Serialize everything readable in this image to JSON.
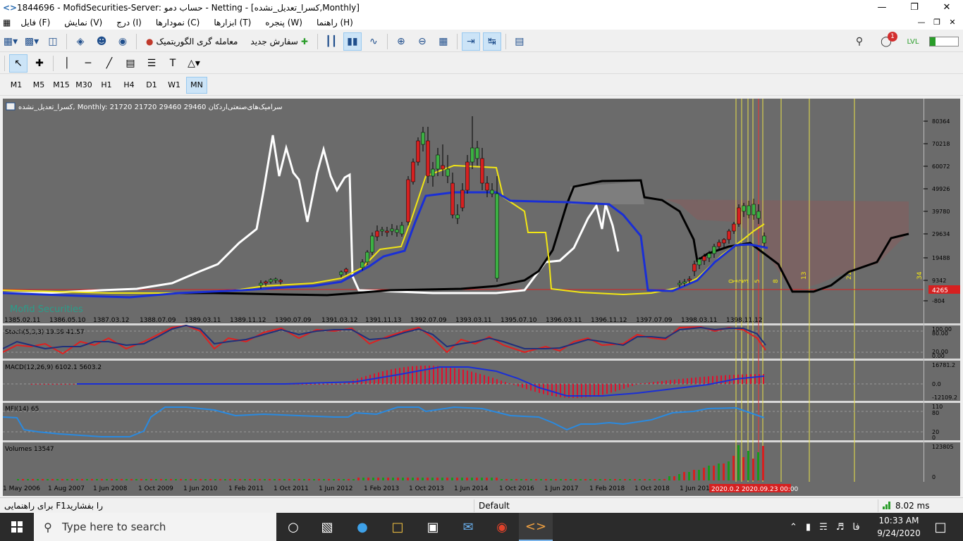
{
  "window": {
    "title": "1844696 - MofidSecurities-Server: حساب دمو - Netting - [کسرا_تعدیل_نشده,Monthly]"
  },
  "menu": [
    "فایل (F)",
    "نمایش (V)",
    "درج (I)",
    "نمودارها (C)",
    "ابزارها (T)",
    "پنجره (W)",
    "راهنما (H)"
  ],
  "toolbar": {
    "algo_label": "معامله گری الگوریتمیک",
    "new_order_label": "سفارش جدید",
    "notification_count": "1"
  },
  "timeframes": [
    "M1",
    "M5",
    "M15",
    "M30",
    "H1",
    "H4",
    "D1",
    "W1",
    "MN"
  ],
  "active_timeframe": "MN",
  "chart": {
    "header": "کسرا_تعدیل_نشده, Monthly:  21720 21720 29460 29460  سرامیک‌های‌صنعتی‌اردکان",
    "watermark": "Mofid Securities",
    "price_axis": [
      "80364",
      "70218",
      "60072",
      "49926",
      "39780",
      "29634",
      "19488",
      "9342",
      "-804"
    ],
    "current_price_label": "4265",
    "date_axis_top": [
      "1385.02.11",
      "1386.05.10",
      "1387.03.12",
      "1388.07.09",
      "1389.03.11",
      "1389.11.12",
      "1390.07.09",
      "1391.03.12",
      "1391.11.13",
      "1392.07.09",
      "1393.03.11",
      "1395.07.10",
      "1396.03.11",
      "1396.11.12",
      "1397.07.09",
      "1398.03.11",
      "1398.11.12"
    ],
    "date_axis_bottom": [
      "1 May 2006",
      "1 Aug 2007",
      "1 Jun 2008",
      "1 Oct 2009",
      "1 Jun 2010",
      "1 Feb 2011",
      "1 Oct 2011",
      "1 Jun 2012",
      "1 Feb 2013",
      "1 Oct 2013",
      "1 Jun 2014",
      "1 Oct 2016",
      "1 Jun 2017",
      "1 Feb 2018",
      "1 Oct 2018",
      "1 Jun 2019"
    ],
    "time_highlight": "2020.0.2  2020.09.23 00:00",
    "fib_labels": [
      "0",
      "1",
      "2",
      "3",
      "5",
      "8",
      "13",
      "21",
      "34"
    ],
    "indicators": {
      "stoch": {
        "label": "Stoch(5,3,3) 19.39 41.57",
        "levels": [
          "100.00",
          "80.00",
          "20.00",
          "0.00"
        ]
      },
      "macd": {
        "label": "MACD(12,26,9) 6102.1 5603.2",
        "levels": [
          "16781.2",
          "0.0",
          "-12109.2"
        ]
      },
      "mfi": {
        "label": "MFI(14) 65",
        "levels": [
          "110",
          "80",
          "20",
          "0"
        ]
      },
      "volumes": {
        "label": "Volumes 13547",
        "levels": [
          "123805",
          "0"
        ]
      }
    }
  },
  "status": {
    "help": "برای راهنمایی F1را بفشارید",
    "profile": "Default",
    "ping": "8.02 ms"
  },
  "taskbar": {
    "search_placeholder": "Type here to search",
    "time": "10:33 AM",
    "date": "9/24/2020",
    "lang": "فا"
  }
}
